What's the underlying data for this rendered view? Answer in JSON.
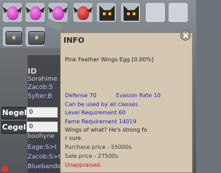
{
  "inventory": {
    "row1": [
      "egg-pink-wings",
      "egg-pink-wings",
      "egg-pink-wings",
      "egg-red-wings",
      "cat-pet",
      "cat-pet",
      "empty",
      "empty",
      "empty"
    ],
    "row2": [
      "chest",
      "chest"
    ]
  },
  "chat": {
    "lines": [
      "ID",
      "Sorahime",
      "Zacob:S",
      "Sylter:B",
      "boohyne",
      "Eage:S>t",
      "Zacob:S>t",
      "Bluebando"
    ]
  },
  "stats": {
    "negel_label": "Negel",
    "negel_value": "0",
    "cegel_label": "Cegel",
    "cegel_value": "0"
  },
  "tooltip": {
    "title": "INFO",
    "item_name": "Pink Feather Wings Egg [0.00%]",
    "defense": "Defense 70",
    "evasion": "Evasion Rate 10",
    "usable": "Can be used by all classes",
    "level_req": "Level Requirement 60",
    "fame_req": "Fame Requirement 14019",
    "desc_line1": "Wings of what? He's strong fo",
    "desc_line2": "r sure.",
    "purchase_price": "Purchase price - 55000s",
    "sale_price": "Sale price - 27500s",
    "appraisal": "Unappraised."
  },
  "colors": {
    "tooltip_bg": "#d4c8b2",
    "blue_text": "#1c26c8",
    "red_text": "#c01414"
  }
}
